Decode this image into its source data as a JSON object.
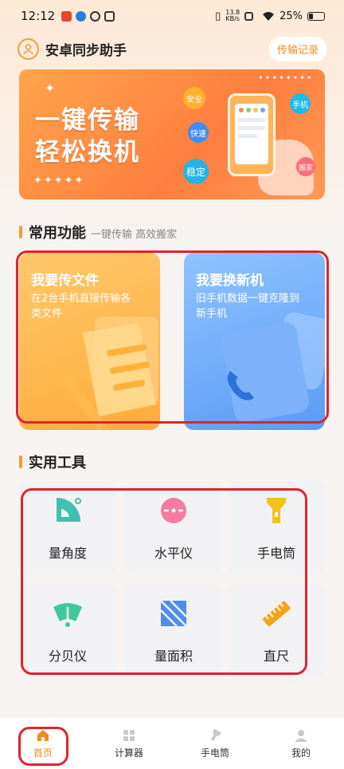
{
  "status_bar": {
    "time": "12:12",
    "net_speed": "13.8",
    "net_unit": "KB/s",
    "battery": "25%"
  },
  "header": {
    "title": "安卓同步助手",
    "record_button": "传输记录"
  },
  "banner": {
    "line1": "一键传输",
    "line2": "轻松换机",
    "tags": [
      "安全",
      "手机",
      "快速",
      "稳定",
      "搬家"
    ]
  },
  "common": {
    "title": "常用功能",
    "subtitle": "一键传输 高效搬家",
    "cards": [
      {
        "title": "我要传文件",
        "desc_line1": "在2台手机直接传输各",
        "desc_line2": "类文件"
      },
      {
        "title": "我要换新机",
        "desc_line1": "旧手机数据一键克隆到",
        "desc_line2": "新手机"
      }
    ]
  },
  "tools": {
    "title": "实用工具",
    "items": [
      {
        "label": "量角度",
        "icon": "protractor-icon"
      },
      {
        "label": "水平仪",
        "icon": "level-icon"
      },
      {
        "label": "手电筒",
        "icon": "flashlight-icon"
      },
      {
        "label": "分贝仪",
        "icon": "decibel-meter-icon"
      },
      {
        "label": "量面积",
        "icon": "area-icon"
      },
      {
        "label": "直尺",
        "icon": "ruler-icon"
      }
    ]
  },
  "bottom_nav": {
    "items": [
      {
        "label": "首页",
        "icon": "home-icon",
        "active": true
      },
      {
        "label": "计算器",
        "icon": "calculator-icon",
        "active": false
      },
      {
        "label": "手电筒",
        "icon": "flashlight-icon",
        "active": false
      },
      {
        "label": "我的",
        "icon": "person-icon",
        "active": false
      }
    ]
  },
  "colors": {
    "accent": "#f08a22",
    "highlight": "#e0232e",
    "card_orange": "#ffab3a",
    "card_blue": "#5a9bf5"
  }
}
